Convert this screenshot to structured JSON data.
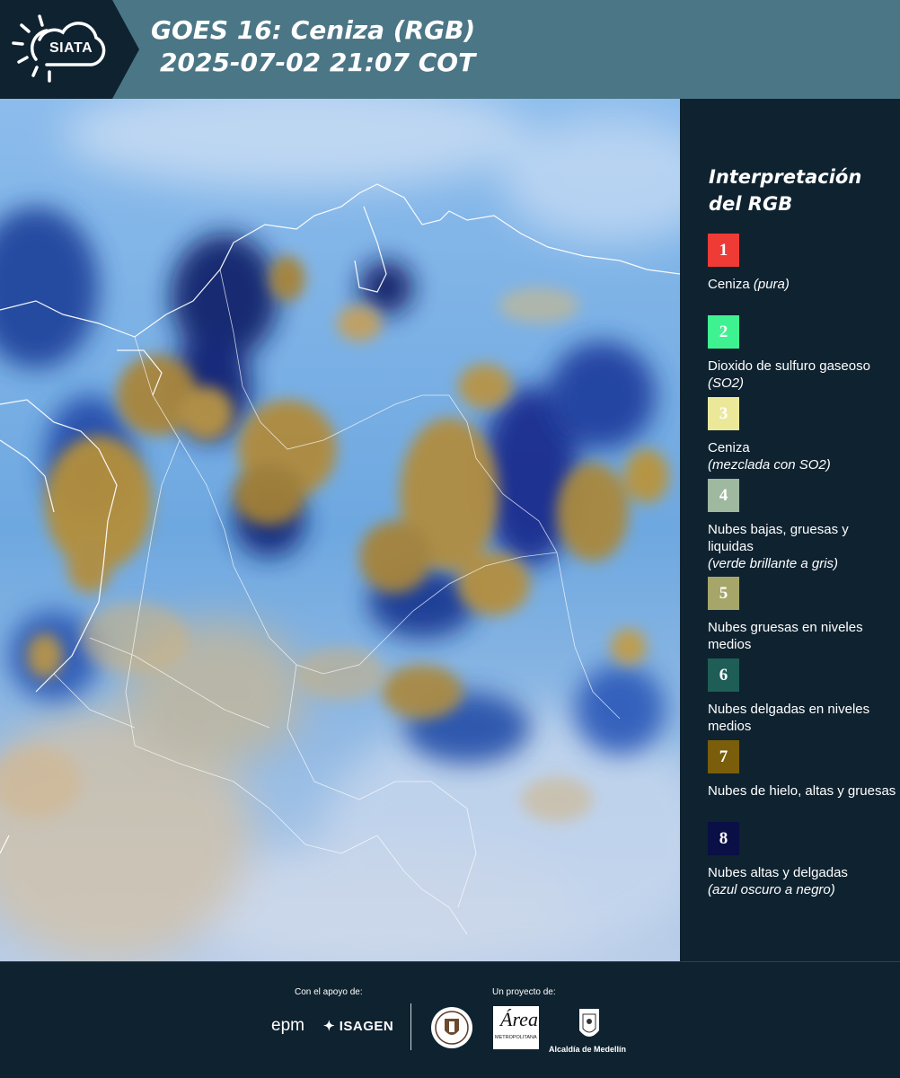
{
  "header": {
    "logo_text": "SIATA",
    "title_line1": "GOES 16: Ceniza (RGB)",
    "title_line2": "2025-07-02 21:07 COT"
  },
  "legend": {
    "title_line1": "Interpretación",
    "title_line2": "del RGB",
    "items": [
      {
        "num": "1",
        "color": "#ef3b36",
        "num_color": "#ffffff",
        "text": "Ceniza ",
        "note": "(pura)"
      },
      {
        "num": "2",
        "color": "#3ff291",
        "num_color": "#ffffff",
        "text": "Dioxido de sulfuro gaseoso ",
        "note": "(SO2)"
      },
      {
        "num": "3",
        "color": "#ece89a",
        "num_color": "#ffffff",
        "text": "Ceniza",
        "note": "(mezclada con SO2)"
      },
      {
        "num": "4",
        "color": "#9fb8a0",
        "num_color": "#ffffff",
        "text": "Nubes bajas, gruesas y liquidas",
        "note": "(verde brillante a gris)"
      },
      {
        "num": "5",
        "color": "#a6a66a",
        "num_color": "#ffffff",
        "text": "Nubes gruesas en niveles medios",
        "note": ""
      },
      {
        "num": "6",
        "color": "#1e5e57",
        "num_color": "#ffffff",
        "text": "Nubes delgadas en niveles medios",
        "note": ""
      },
      {
        "num": "7",
        "color": "#7a5e0c",
        "num_color": "#ffffff",
        "text": "Nubes de hielo, altas y gruesas",
        "note": ""
      },
      {
        "num": "8",
        "color": "#0a0f46",
        "num_color": "#ffffff",
        "text": "Nubes altas y delgadas",
        "note": "(azul oscuro a negro)"
      }
    ]
  },
  "footer": {
    "support_label": "Con el apoyo de:",
    "project_label": "Un proyecto de:",
    "epm": "epm",
    "isagen": "ISAGEN",
    "area_title": "Área",
    "area_sub": "METROPOLITANA",
    "alcaldia": "Alcaldía de Medellín"
  }
}
